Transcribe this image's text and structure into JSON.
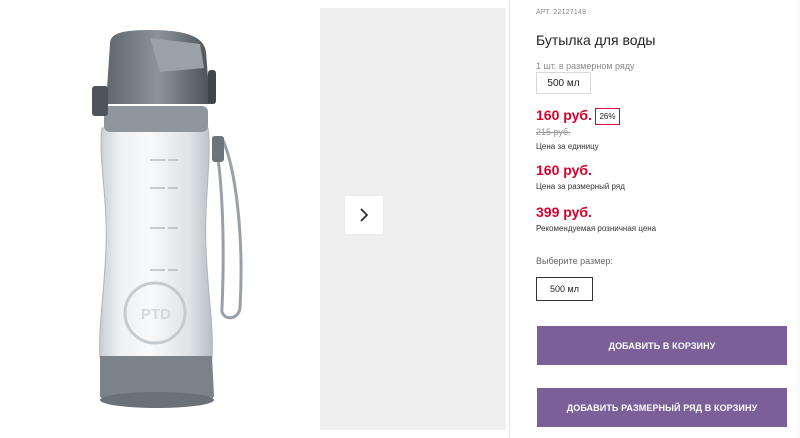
{
  "product": {
    "article": "АРТ. 22127149",
    "title": "Бутылка для воды",
    "pack_label": "1 шт. в размерном ряду",
    "pack_value": "500 мл",
    "bottle_logo": "PTD"
  },
  "prices": {
    "main": "160 руб.",
    "discount": "26%",
    "old": "215 руб.",
    "unit_label": "Цена за единицу",
    "range": "160 руб.",
    "range_label": "Цена за размерный ряд",
    "retail": "399 руб.",
    "retail_label": "Рекомендуемая розничная цена"
  },
  "size": {
    "label": "Выберите размер:",
    "selected": "500 мл"
  },
  "buttons": {
    "add_to_cart": "ДОБАВИТЬ В КОРЗИНУ",
    "add_range_to_cart": "ДОБАВИТЬ РАЗМЕРНЫЙ РЯД В КОРЗИНУ"
  },
  "colors": {
    "price_red": "#d8002a",
    "button_purple": "#7b5f99",
    "thumb_panel": "#efefef"
  },
  "icons": {
    "next": "chevron-right-icon"
  }
}
